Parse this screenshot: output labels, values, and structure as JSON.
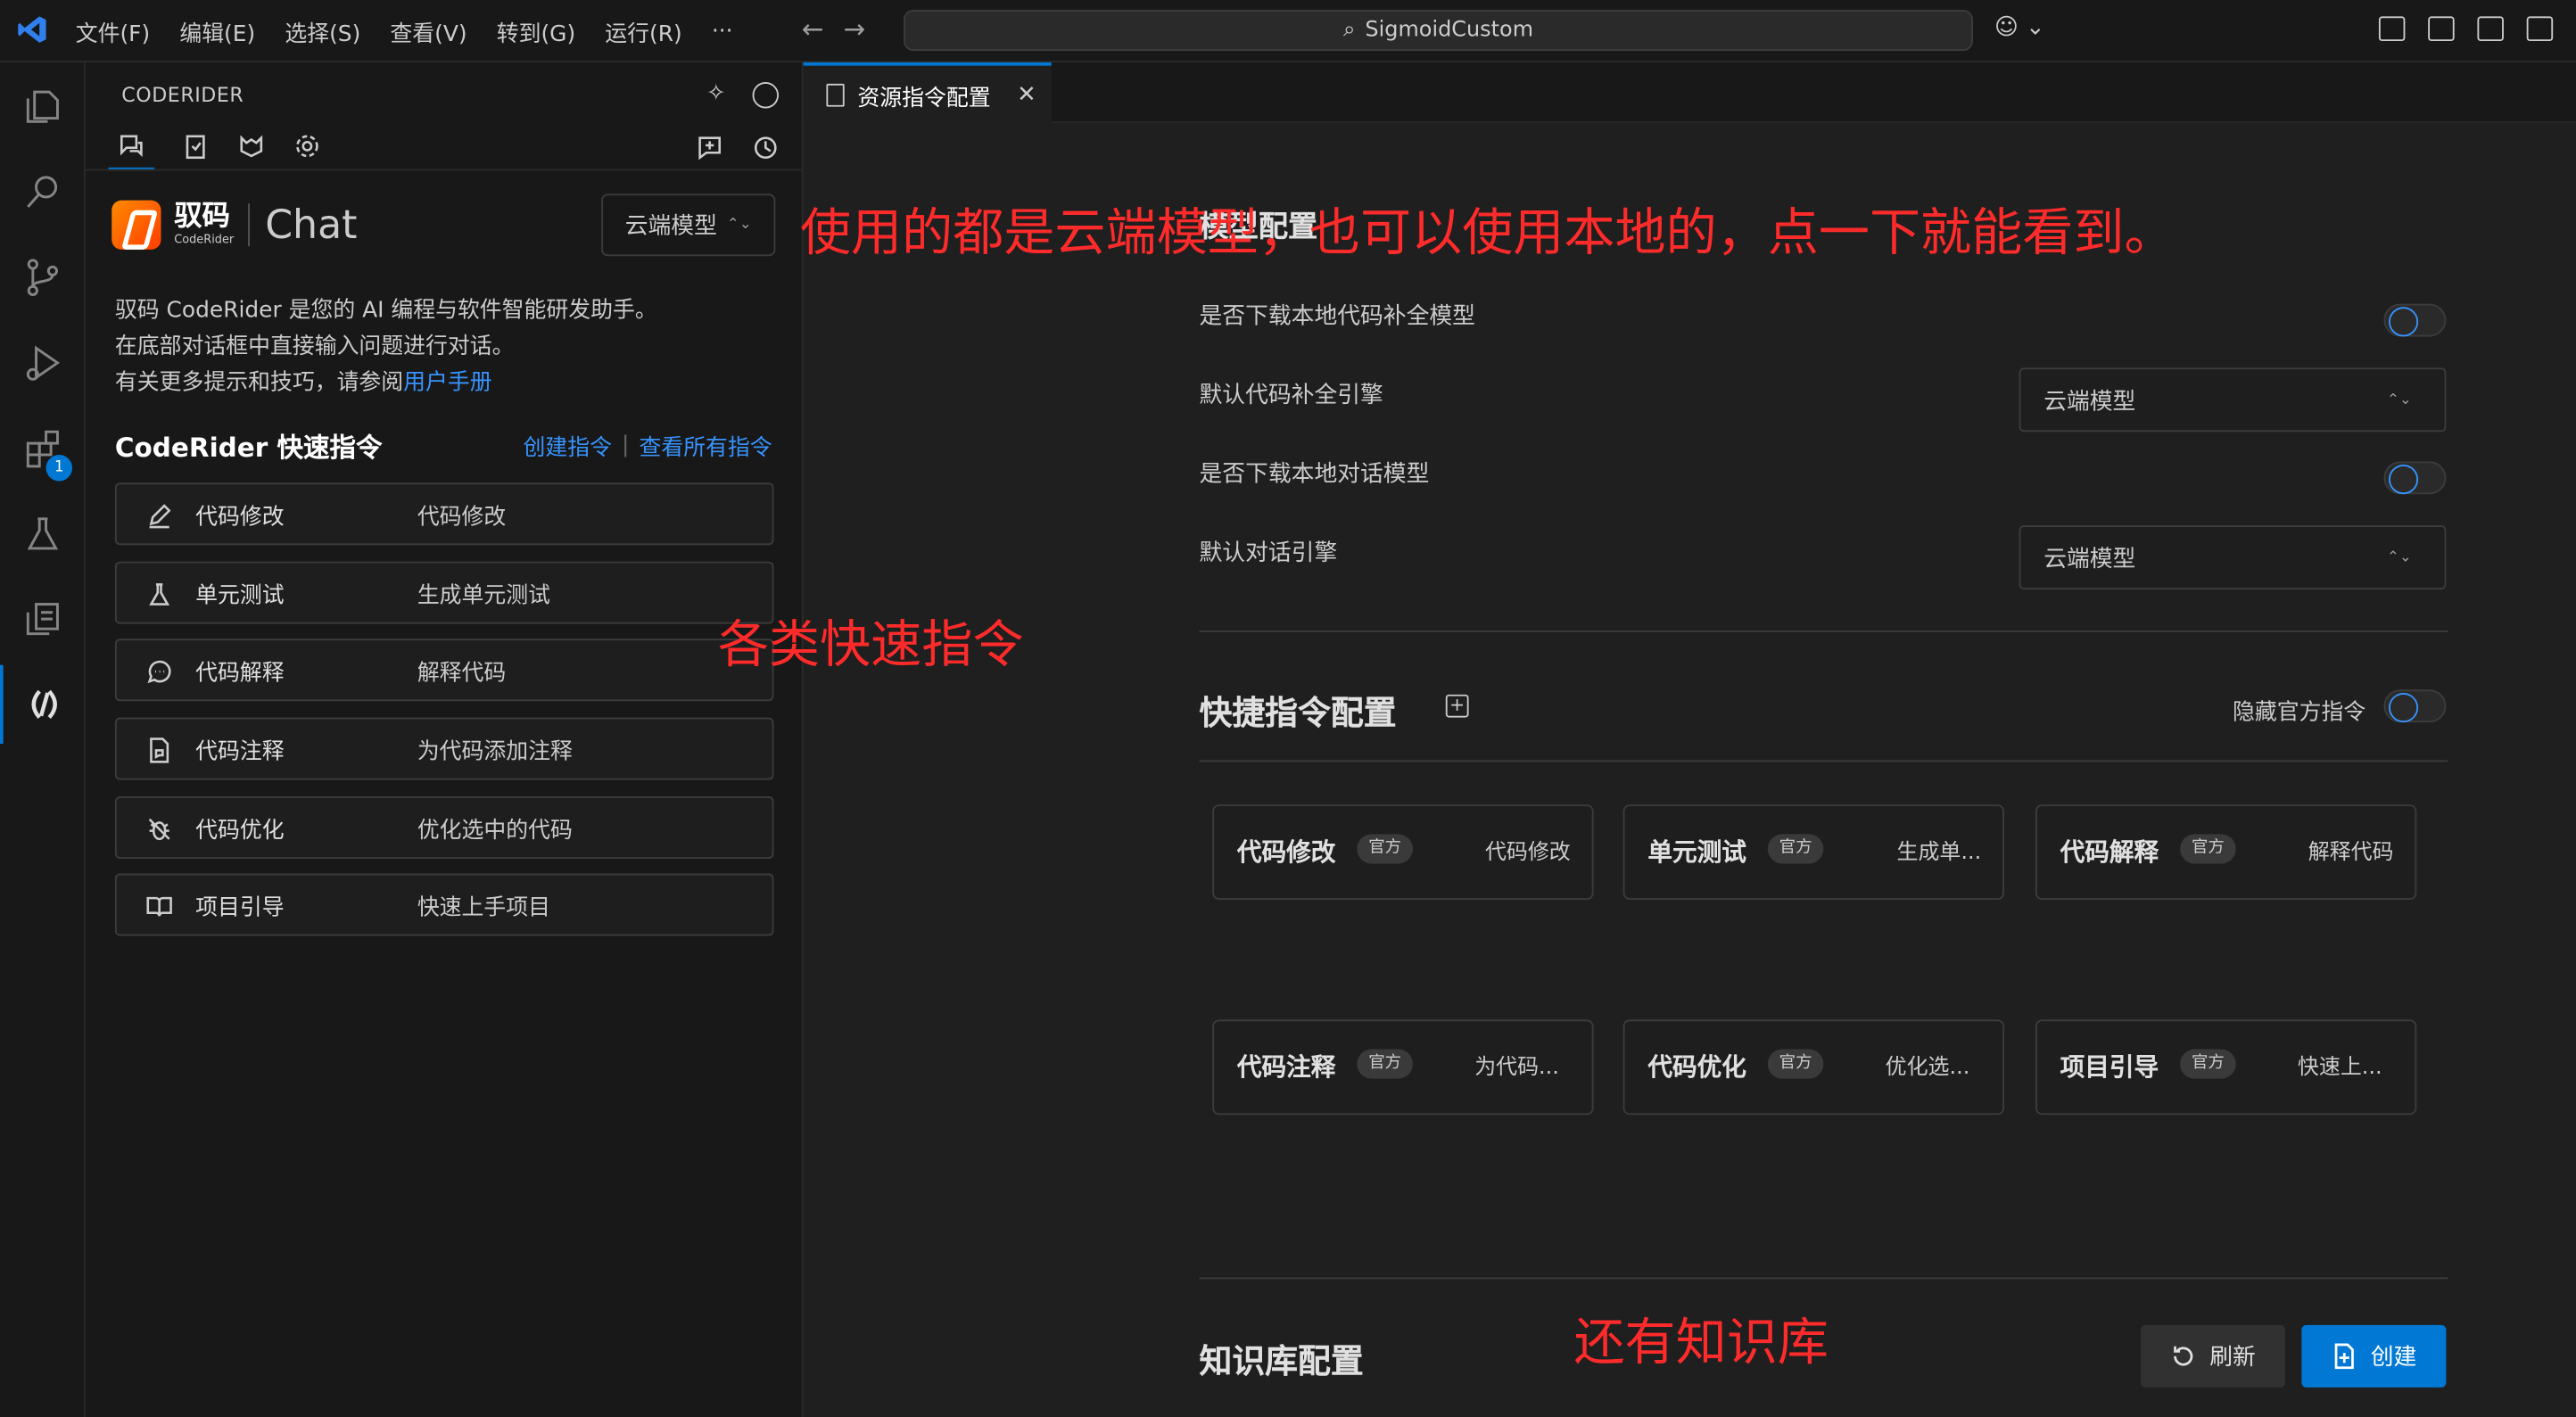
{
  "titlebar": {
    "menus": [
      "文件(F)",
      "编辑(E)",
      "选择(S)",
      "查看(V)",
      "转到(G)",
      "运行(R)",
      "···"
    ],
    "search_text": "SigmoidCustom"
  },
  "activity": {
    "extensions_badge": "1"
  },
  "sidebar": {
    "title": "CODERIDER",
    "brand_zh": "驭码",
    "brand_en": "CodeRider",
    "brand_chat": "Chat",
    "model_select": "云端模型",
    "intro_line1": "驭码 CodeRider 是您的 AI 编程与软件智能研发助手。",
    "intro_line2": "在底部对话框中直接输入问题进行对话。",
    "intro_line3": "有关更多提示和技巧，请参阅",
    "intro_link": "用户手册",
    "quick_title": "CodeRider 快速指令",
    "create_cmd": "创建指令",
    "view_all_cmd": "查看所有指令",
    "commands": [
      {
        "name": "代码修改",
        "desc": "代码修改",
        "icon": "pencil-icon"
      },
      {
        "name": "单元测试",
        "desc": "生成单元测试",
        "icon": "flask-icon"
      },
      {
        "name": "代码解释",
        "desc": "解释代码",
        "icon": "chat-bubble-icon"
      },
      {
        "name": "代码注释",
        "desc": "为代码添加注释",
        "icon": "file-comment-icon"
      },
      {
        "name": "代码优化",
        "desc": "优化选中的代码",
        "icon": "bug-off-icon"
      },
      {
        "name": "项目引导",
        "desc": "快速上手项目",
        "icon": "book-icon"
      }
    ]
  },
  "editor": {
    "tab_label": "资源指令配置",
    "model_config_title": "模型配置",
    "settings": [
      {
        "label": "是否下载本地代码补全模型"
      },
      {
        "label": "默认代码补全引擎",
        "value": "云端模型"
      },
      {
        "label": "是否下载本地对话模型"
      },
      {
        "label": "默认对话引擎",
        "value": "云端模型"
      }
    ],
    "shortcut_title": "快捷指令配置",
    "hide_official": "隐藏官方指令",
    "cards": [
      {
        "name": "代码修改",
        "badge": "官方",
        "desc": "代码修改"
      },
      {
        "name": "单元测试",
        "badge": "官方",
        "desc": "生成单..."
      },
      {
        "name": "代码解释",
        "badge": "官方",
        "desc": "解释代码"
      },
      {
        "name": "代码注释",
        "badge": "官方",
        "desc": "为代码..."
      },
      {
        "name": "代码优化",
        "badge": "官方",
        "desc": "优化选..."
      },
      {
        "name": "项目引导",
        "badge": "官方",
        "desc": "快速上..."
      }
    ],
    "kb_title": "知识库配置",
    "refresh": "刷新",
    "create": "创建"
  },
  "annotations": {
    "top": "使用的都是云端模型，也可以使用本地的，点一下就能看到。",
    "middle": "各类快速指令",
    "bottom": "还有知识库"
  }
}
